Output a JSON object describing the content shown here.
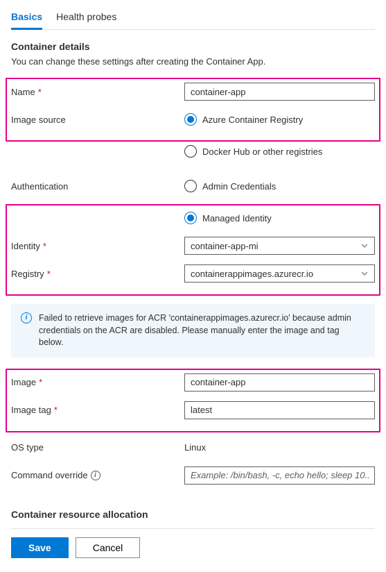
{
  "tabs": {
    "basics": "Basics",
    "health": "Health probes"
  },
  "section": {
    "title": "Container details",
    "desc": "You can change these settings after creating the Container App."
  },
  "fields": {
    "name": {
      "label": "Name",
      "value": "container-app"
    },
    "imageSource": {
      "label": "Image source",
      "opt1": "Azure Container Registry",
      "opt2": "Docker Hub or other registries"
    },
    "auth": {
      "label": "Authentication",
      "opt1": "Admin Credentials",
      "opt2": "Managed Identity"
    },
    "identity": {
      "label": "Identity",
      "value": "container-app-mi"
    },
    "registry": {
      "label": "Registry",
      "value": "containerappimages.azurecr.io"
    },
    "image": {
      "label": "Image",
      "value": "container-app"
    },
    "imageTag": {
      "label": "Image tag",
      "value": "latest"
    },
    "osType": {
      "label": "OS type",
      "value": "Linux"
    },
    "command": {
      "label": "Command override",
      "placeholder": "Example: /bin/bash, -c, echo hello; sleep 10..."
    }
  },
  "info": {
    "message": "Failed to retrieve images for ACR 'containerappimages.azurecr.io' because admin credentials on the ACR are disabled. Please manually enter the image and tag below."
  },
  "resource": {
    "title": "Container resource allocation"
  },
  "buttons": {
    "save": "Save",
    "cancel": "Cancel"
  }
}
